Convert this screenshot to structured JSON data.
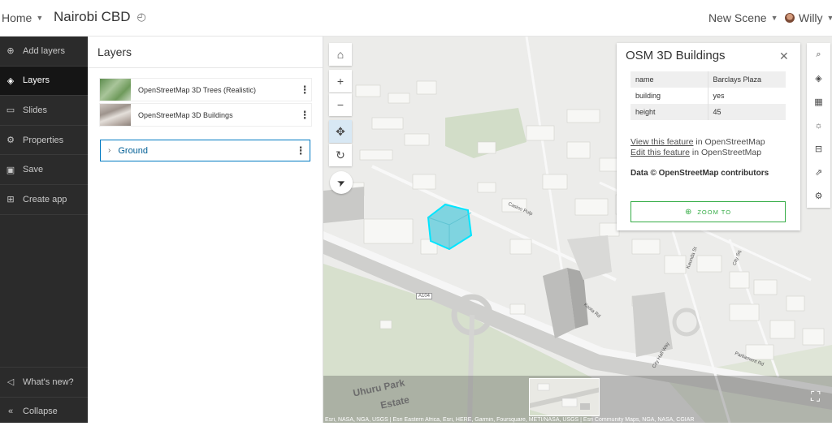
{
  "header": {
    "home": "Home",
    "title": "Nairobi CBD",
    "new_scene": "New Scene",
    "user": "Willy"
  },
  "nav": {
    "items": [
      {
        "label": "Add layers",
        "icon": "plus-circle-icon"
      },
      {
        "label": "Layers",
        "icon": "layers-icon",
        "active": true
      },
      {
        "label": "Slides",
        "icon": "slides-icon"
      },
      {
        "label": "Properties",
        "icon": "gear-icon"
      },
      {
        "label": "Save",
        "icon": "save-icon"
      },
      {
        "label": "Create app",
        "icon": "grid-icon"
      }
    ],
    "whats_new": "What's new?",
    "collapse": "Collapse"
  },
  "layers_panel": {
    "title": "Layers",
    "layers": [
      {
        "label": "OpenStreetMap 3D Trees (Realistic)"
      },
      {
        "label": "OpenStreetMap 3D Buildings"
      }
    ],
    "ground": "Ground"
  },
  "popup": {
    "title": "OSM 3D Buildings",
    "fields": [
      {
        "key": "name",
        "value": "Barclays Plaza"
      },
      {
        "key": "building",
        "value": "yes"
      },
      {
        "key": "height",
        "value": "45"
      }
    ],
    "link1": "View this feature",
    "link1_suffix": " in OpenStreetMap",
    "link2": "Edit this feature",
    "link2_suffix": " in OpenStreetMap",
    "credit": "Data © OpenStreetMap contributors",
    "zoom_to": "ZOOM TO"
  },
  "map": {
    "labels": {
      "uhuru": "Uhuru Park",
      "estate": "Estate",
      "a104": "A104",
      "parliament": "Parliament Rd",
      "city_hall": "City Hall Way",
      "kosta": "Kosta Rd",
      "casino": "Casino Pulp",
      "kaunda": "Kaunda St",
      "city_sq": "City Sq"
    },
    "attribution": "Esri, NASA, NGA, USGS | Esri Eastern Africa, Esri, HERE, Garmin, Foursquare, METI/NASA, USGS | Esri Community Maps, NGA, NASA, CGIAR"
  },
  "colors": {
    "accent": "#007ac2",
    "highlight": "#00e5ff",
    "zoom_green": "#35ac46",
    "nav_bg": "#2b2b2b"
  }
}
